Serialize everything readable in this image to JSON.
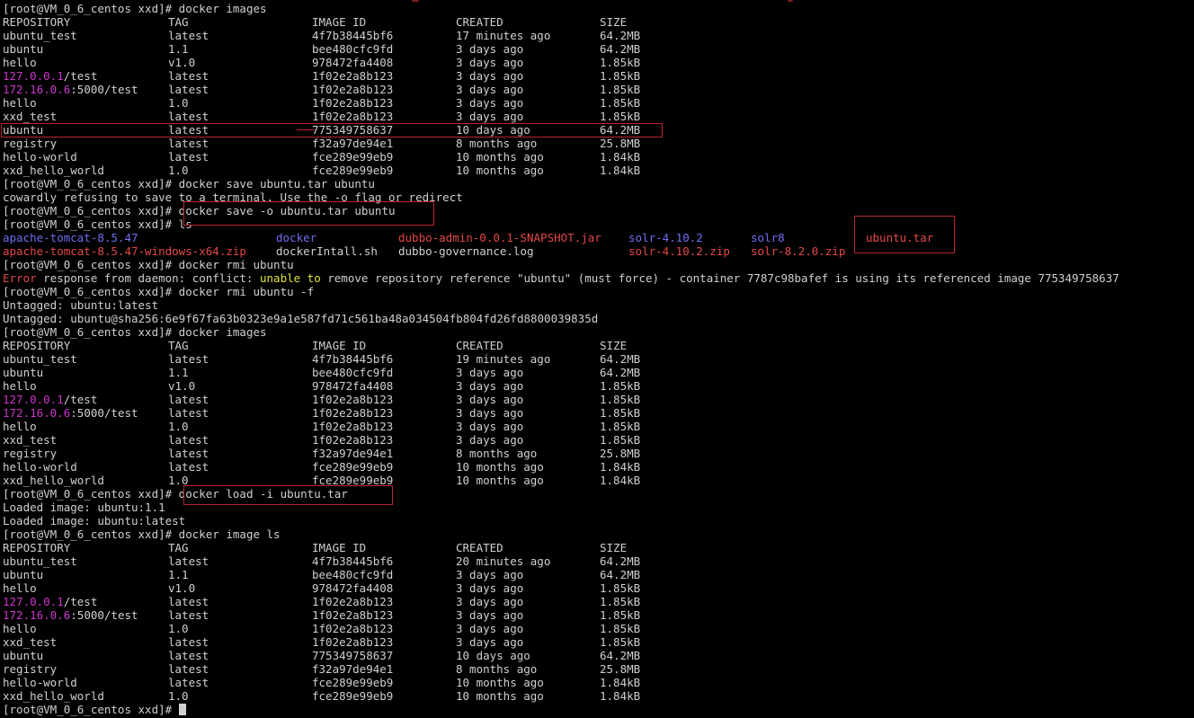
{
  "colors": {
    "background": "#000000",
    "text": "#d0d0d0",
    "ip": "#cc36cc",
    "dir": "#6f6ff2",
    "archive": "#e34848",
    "error": "#e34848",
    "warn": "#e4e43a",
    "highlight_box": "#b8262b"
  },
  "prompt": "[root@VM_0_6_centos xxd]#",
  "table_headers": {
    "repo": "REPOSITORY",
    "tag": "TAG",
    "id": "IMAGE ID",
    "created": "CREATED",
    "size": "SIZE"
  },
  "rows": [
    {
      "type": "cmd",
      "text": " docker images"
    },
    {
      "type": "header"
    },
    {
      "type": "img",
      "repo": "ubuntu_test",
      "tag": "latest",
      "id": "4f7b38445bf6",
      "created": "17 minutes ago",
      "size": "64.2MB"
    },
    {
      "type": "img",
      "repo": "ubuntu",
      "tag": "1.1",
      "id": "bee480cfc9fd",
      "created": "3 days ago",
      "size": "64.2MB"
    },
    {
      "type": "img",
      "repo": "hello",
      "tag": "v1.0",
      "id": "978472fa4408",
      "created": "3 days ago",
      "size": "1.85kB"
    },
    {
      "type": "img",
      "repo_ip": "127.0.0.1",
      "repo_rest": "/test",
      "tag": "latest",
      "id": "1f02e2a8b123",
      "created": "3 days ago",
      "size": "1.85kB"
    },
    {
      "type": "img",
      "repo_ip": "172.16.0.6",
      "repo_rest": ":5000/test",
      "tag": "latest",
      "id": "1f02e2a8b123",
      "created": "3 days ago",
      "size": "1.85kB"
    },
    {
      "type": "img",
      "repo": "hello",
      "tag": "1.0",
      "id": "1f02e2a8b123",
      "created": "3 days ago",
      "size": "1.85kB"
    },
    {
      "type": "img",
      "repo": "xxd_test",
      "tag": "latest",
      "id": "1f02e2a8b123",
      "created": "3 days ago",
      "size": "1.85kB"
    },
    {
      "type": "img",
      "repo": "ubuntu",
      "tag": "latest",
      "id": "775349758637",
      "created": "10 days ago",
      "size": "64.2MB"
    },
    {
      "type": "img",
      "repo": "registry",
      "tag": "latest",
      "id": "f32a97de94e1",
      "created": "8 months ago",
      "size": "25.8MB"
    },
    {
      "type": "img",
      "repo": "hello-world",
      "tag": "latest",
      "id": "fce289e99eb9",
      "created": "10 months ago",
      "size": "1.84kB"
    },
    {
      "type": "img",
      "repo": "xxd_hello_world",
      "tag": "1.0",
      "id": "fce289e99eb9",
      "created": "10 months ago",
      "size": "1.84kB"
    },
    {
      "type": "cmd",
      "text": " docker save ubuntu.tar ubuntu"
    },
    {
      "type": "out",
      "text": "cowardly refusing to save to a terminal. Use the -o flag or redirect"
    },
    {
      "type": "cmd",
      "text": " docker save -o ubuntu.tar ubuntu"
    },
    {
      "type": "cmd",
      "text": " ls"
    },
    {
      "type": "ls",
      "items": [
        {
          "text": "apache-tomcat-8.5.47",
          "kind": "dir"
        },
        {
          "text": "docker",
          "kind": "dir"
        },
        {
          "text": "dubbo-admin-0.0.1-SNAPSHOT.jar",
          "kind": "archive"
        },
        {
          "text": "solr-4.10.2",
          "kind": "dir"
        },
        {
          "text": "solr8",
          "kind": "dir"
        },
        {
          "text": "ubuntu.tar",
          "kind": "archive"
        }
      ]
    },
    {
      "type": "ls",
      "items": [
        {
          "text": "apache-tomcat-8.5.47-windows-x64.zip",
          "kind": "archive"
        },
        {
          "text": "dockerIntall.sh",
          "kind": "plain"
        },
        {
          "text": "dubbo-governance.log",
          "kind": "plain"
        },
        {
          "text": "solr-4.10.2.zip",
          "kind": "archive"
        },
        {
          "text": "solr-8.2.0.zip",
          "kind": "archive"
        }
      ]
    },
    {
      "type": "cmd",
      "text": " docker rmi ubuntu"
    },
    {
      "type": "segs",
      "segs": [
        {
          "text": "Error",
          "kind": "error"
        },
        {
          "text": " response from daemon: conflict: ",
          "kind": "plain"
        },
        {
          "text": "unable to",
          "kind": "warn"
        },
        {
          "text": " remove repository reference \"ubuntu\" (must force) - container 7787c98bafef is using its referenced image 775349758637",
          "kind": "plain"
        }
      ]
    },
    {
      "type": "cmd",
      "text": " docker rmi ubuntu -f"
    },
    {
      "type": "out",
      "text": "Untagged: ubuntu:latest"
    },
    {
      "type": "out",
      "text": "Untagged: ubuntu@sha256:6e9f67fa63b0323e9a1e587fd71c561ba48a034504fb804fd26fd8800039835d"
    },
    {
      "type": "cmd",
      "text": " docker images"
    },
    {
      "type": "header"
    },
    {
      "type": "img",
      "repo": "ubuntu_test",
      "tag": "latest",
      "id": "4f7b38445bf6",
      "created": "19 minutes ago",
      "size": "64.2MB"
    },
    {
      "type": "img",
      "repo": "ubuntu",
      "tag": "1.1",
      "id": "bee480cfc9fd",
      "created": "3 days ago",
      "size": "64.2MB"
    },
    {
      "type": "img",
      "repo": "hello",
      "tag": "v1.0",
      "id": "978472fa4408",
      "created": "3 days ago",
      "size": "1.85kB"
    },
    {
      "type": "img",
      "repo_ip": "127.0.0.1",
      "repo_rest": "/test",
      "tag": "latest",
      "id": "1f02e2a8b123",
      "created": "3 days ago",
      "size": "1.85kB"
    },
    {
      "type": "img",
      "repo_ip": "172.16.0.6",
      "repo_rest": ":5000/test",
      "tag": "latest",
      "id": "1f02e2a8b123",
      "created": "3 days ago",
      "size": "1.85kB"
    },
    {
      "type": "img",
      "repo": "hello",
      "tag": "1.0",
      "id": "1f02e2a8b123",
      "created": "3 days ago",
      "size": "1.85kB"
    },
    {
      "type": "img",
      "repo": "xxd_test",
      "tag": "latest",
      "id": "1f02e2a8b123",
      "created": "3 days ago",
      "size": "1.85kB"
    },
    {
      "type": "img",
      "repo": "registry",
      "tag": "latest",
      "id": "f32a97de94e1",
      "created": "8 months ago",
      "size": "25.8MB"
    },
    {
      "type": "img",
      "repo": "hello-world",
      "tag": "latest",
      "id": "fce289e99eb9",
      "created": "10 months ago",
      "size": "1.84kB"
    },
    {
      "type": "img",
      "repo": "xxd_hello_world",
      "tag": "1.0",
      "id": "fce289e99eb9",
      "created": "10 months ago",
      "size": "1.84kB"
    },
    {
      "type": "cmd",
      "text": " docker load -i ubuntu.tar"
    },
    {
      "type": "out",
      "text": "Loaded image: ubuntu:1.1"
    },
    {
      "type": "out",
      "text": "Loaded image: ubuntu:latest"
    },
    {
      "type": "cmd",
      "text": " docker image ls"
    },
    {
      "type": "header"
    },
    {
      "type": "img",
      "repo": "ubuntu_test",
      "tag": "latest",
      "id": "4f7b38445bf6",
      "created": "20 minutes ago",
      "size": "64.2MB"
    },
    {
      "type": "img",
      "repo": "ubuntu",
      "tag": "1.1",
      "id": "bee480cfc9fd",
      "created": "3 days ago",
      "size": "64.2MB"
    },
    {
      "type": "img",
      "repo": "hello",
      "tag": "v1.0",
      "id": "978472fa4408",
      "created": "3 days ago",
      "size": "1.85kB"
    },
    {
      "type": "img",
      "repo_ip": "127.0.0.1",
      "repo_rest": "/test",
      "tag": "latest",
      "id": "1f02e2a8b123",
      "created": "3 days ago",
      "size": "1.85kB"
    },
    {
      "type": "img",
      "repo_ip": "172.16.0.6",
      "repo_rest": ":5000/test",
      "tag": "latest",
      "id": "1f02e2a8b123",
      "created": "3 days ago",
      "size": "1.85kB"
    },
    {
      "type": "img",
      "repo": "hello",
      "tag": "1.0",
      "id": "1f02e2a8b123",
      "created": "3 days ago",
      "size": "1.85kB"
    },
    {
      "type": "img",
      "repo": "xxd_test",
      "tag": "latest",
      "id": "1f02e2a8b123",
      "created": "3 days ago",
      "size": "1.85kB"
    },
    {
      "type": "img",
      "repo": "ubuntu",
      "tag": "latest",
      "id": "775349758637",
      "created": "10 days ago",
      "size": "64.2MB"
    },
    {
      "type": "img",
      "repo": "registry",
      "tag": "latest",
      "id": "f32a97de94e1",
      "created": "8 months ago",
      "size": "25.8MB"
    },
    {
      "type": "img",
      "repo": "hello-world",
      "tag": "latest",
      "id": "fce289e99eb9",
      "created": "10 months ago",
      "size": "1.84kB"
    },
    {
      "type": "img",
      "repo": "xxd_hello_world",
      "tag": "1.0",
      "id": "fce289e99eb9",
      "created": "10 months ago",
      "size": "1.84kB"
    },
    {
      "type": "cmd",
      "text": " ",
      "cursor": true
    }
  ]
}
